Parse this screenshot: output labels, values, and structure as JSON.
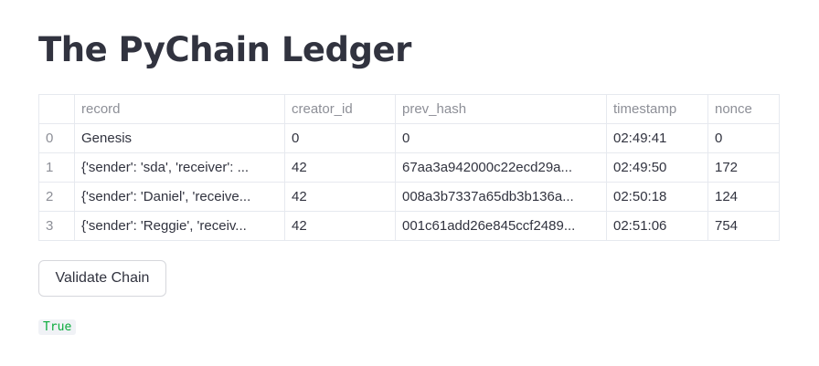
{
  "page": {
    "title": "The PyChain Ledger"
  },
  "table": {
    "columns": [
      "",
      "record",
      "creator_id",
      "prev_hash",
      "timestamp",
      "nonce"
    ],
    "rows": [
      {
        "index": "0",
        "record": "Genesis",
        "creator_id": "0",
        "prev_hash": "0",
        "timestamp": "02:49:41",
        "nonce": "0"
      },
      {
        "index": "1",
        "record": "{'sender': 'sda', 'receiver': ...",
        "creator_id": "42",
        "prev_hash": "67aa3a942000c22ecd29a...",
        "timestamp": "02:49:50",
        "nonce": "172"
      },
      {
        "index": "2",
        "record": "{'sender': 'Daniel', 'receive...",
        "creator_id": "42",
        "prev_hash": "008a3b7337a65db3b136a...",
        "timestamp": "02:50:18",
        "nonce": "124"
      },
      {
        "index": "3",
        "record": "{'sender': 'Reggie', 'receiv...",
        "creator_id": "42",
        "prev_hash": "001c61add26e845ccf2489...",
        "timestamp": "02:51:06",
        "nonce": "754"
      }
    ]
  },
  "actions": {
    "validate_label": "Validate Chain"
  },
  "result": {
    "text": "True",
    "color": "#09ab3b"
  }
}
